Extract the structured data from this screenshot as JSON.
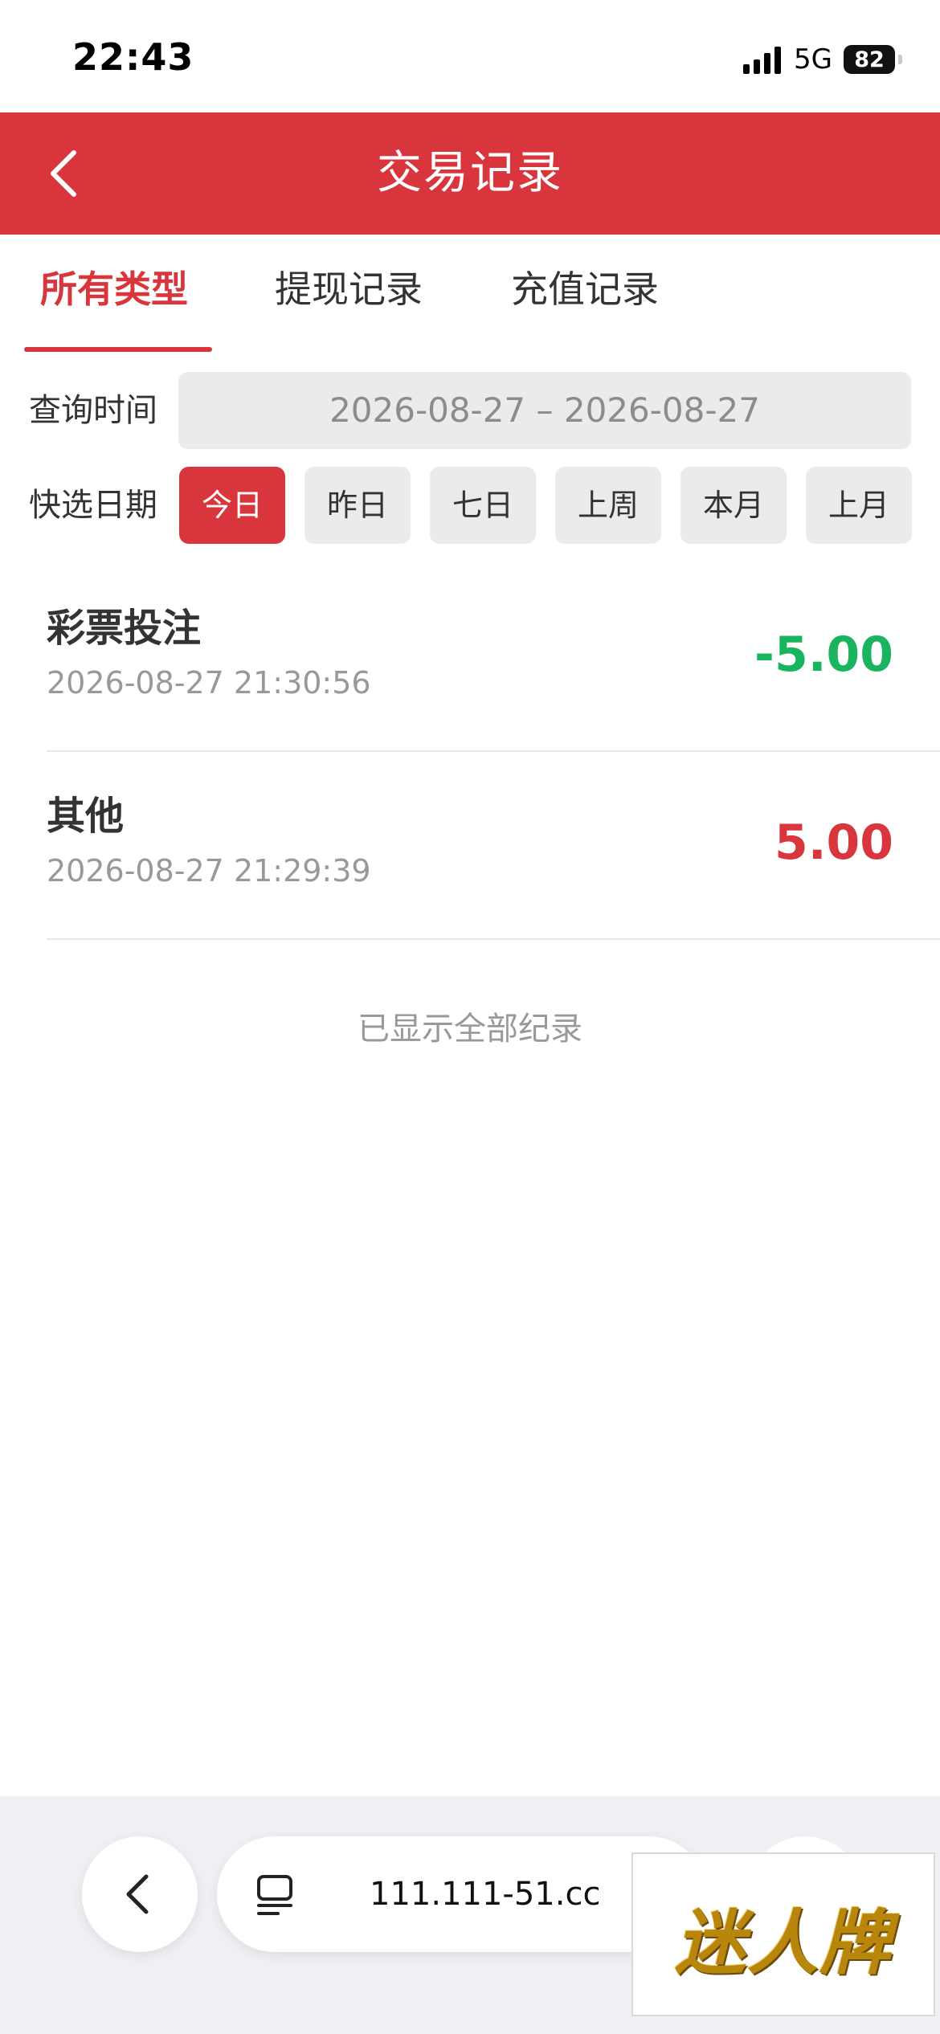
{
  "status_bar": {
    "time": "22:43",
    "network": "5G",
    "battery": "82"
  },
  "header": {
    "title": "交易记录"
  },
  "tabs": [
    {
      "label": "所有类型",
      "active": true
    },
    {
      "label": "提现记录",
      "active": false
    },
    {
      "label": "充值记录",
      "active": false
    }
  ],
  "query": {
    "time_label": "查询时间",
    "date_range": "2026-08-27 – 2026-08-27",
    "quick_label": "快选日期",
    "quick_options": [
      "今日",
      "昨日",
      "七日",
      "上周",
      "本月",
      "上月"
    ],
    "quick_selected": "今日"
  },
  "records": [
    {
      "title": "彩票投注",
      "time": "2026-08-27 21:30:56",
      "amount": "-5.00",
      "type": "debit"
    },
    {
      "title": "其他",
      "time": "2026-08-27 21:29:39",
      "amount": "5.00",
      "type": "credit"
    }
  ],
  "end_note": "已显示全部纪录",
  "browser": {
    "url": "111.111-51.cc"
  },
  "watermark": "迷人牌",
  "colors": {
    "primary": "#d8363c",
    "debit": "#1ab45e",
    "credit": "#d8363c"
  }
}
